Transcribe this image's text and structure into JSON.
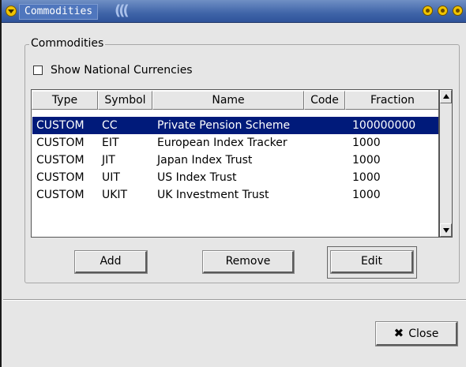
{
  "window": {
    "title": "Commodities",
    "menu_icon": "window-menu-icon",
    "controls": [
      "minimize-icon",
      "maximize-icon",
      "close-icon"
    ],
    "accent_color": "#3f64a8"
  },
  "group": {
    "label": "Commodities"
  },
  "show_national_currencies": {
    "label": "Show National Currencies",
    "checked": false
  },
  "table": {
    "columns": [
      "Type",
      "Symbol",
      "Name",
      "Code",
      "Fraction"
    ],
    "rows": [
      {
        "type": "CUSTOM",
        "symbol": "CC",
        "name": "Private Pension Scheme",
        "code": "",
        "fraction": "100000000",
        "selected": true
      },
      {
        "type": "CUSTOM",
        "symbol": "EIT",
        "name": "European Index Tracker",
        "code": "",
        "fraction": "1000",
        "selected": false
      },
      {
        "type": "CUSTOM",
        "symbol": "JIT",
        "name": "Japan Index Trust",
        "code": "",
        "fraction": "1000",
        "selected": false
      },
      {
        "type": "CUSTOM",
        "symbol": "UIT",
        "name": "US Index Trust",
        "code": "",
        "fraction": "1000",
        "selected": false
      },
      {
        "type": "CUSTOM",
        "symbol": "UKIT",
        "name": "UK Investment Trust",
        "code": "",
        "fraction": "1000",
        "selected": false
      }
    ],
    "selection_color": "#001a7a"
  },
  "buttons": {
    "add": "Add",
    "remove": "Remove",
    "edit": "Edit",
    "close": "Close",
    "close_icon": "close-x-icon"
  }
}
